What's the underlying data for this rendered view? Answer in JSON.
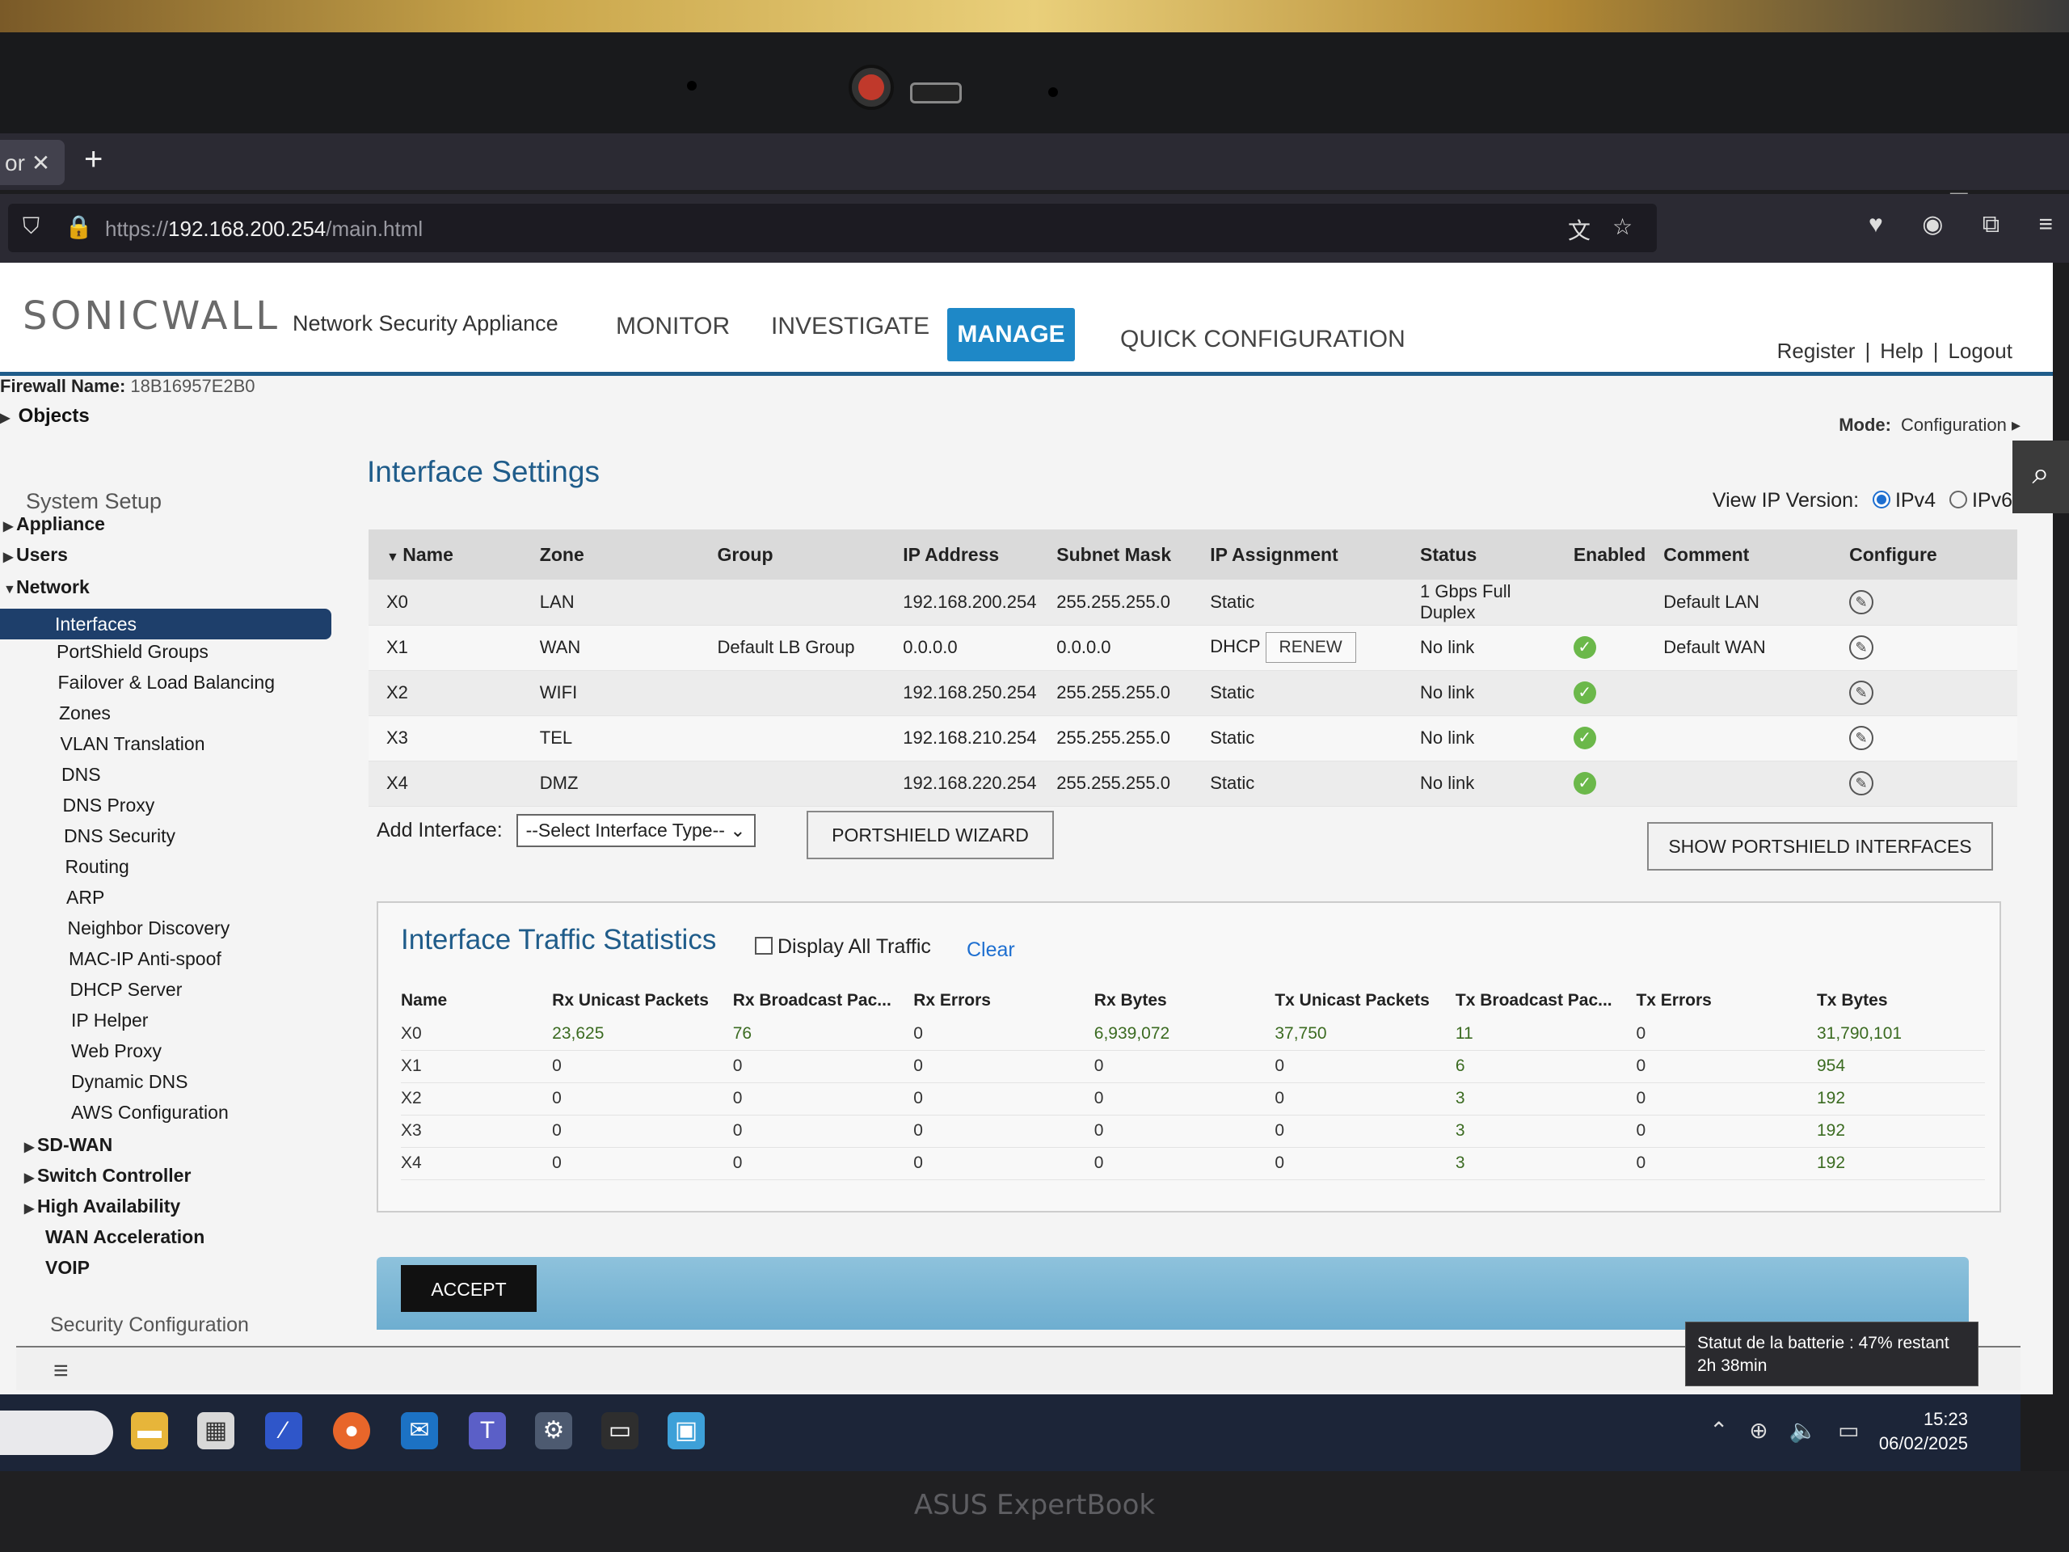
{
  "brand": "ASUS ExpertBook",
  "browser": {
    "tab_label": "or",
    "url_protocol": "https://",
    "url_host": "192.168.200.254",
    "url_path": "/main.html"
  },
  "header": {
    "logo": "SONICWALL",
    "product": "Network Security Appliance",
    "nav": [
      "MONITOR",
      "INVESTIGATE",
      "MANAGE",
      "QUICK CONFIGURATION"
    ],
    "links": [
      "Register",
      "Help",
      "Logout"
    ]
  },
  "firewall": {
    "label": "Firewall Name:",
    "value": "18B16957E2B0"
  },
  "objects": "Objects",
  "mode": {
    "label": "Mode:",
    "value": "Configuration"
  },
  "sidebar": {
    "system_setup": "System Setup",
    "items": [
      {
        "label": "Appliance",
        "bold": true
      },
      {
        "label": "Users",
        "bold": true
      },
      {
        "label": "Network",
        "bold": true
      },
      {
        "label": "Interfaces",
        "active": true
      },
      {
        "label": "PortShield Groups"
      },
      {
        "label": "Failover & Load Balancing"
      },
      {
        "label": "Zones"
      },
      {
        "label": "VLAN Translation"
      },
      {
        "label": "DNS"
      },
      {
        "label": "DNS Proxy"
      },
      {
        "label": "DNS Security"
      },
      {
        "label": "Routing"
      },
      {
        "label": "ARP"
      },
      {
        "label": "Neighbor Discovery"
      },
      {
        "label": "MAC-IP Anti-spoof"
      },
      {
        "label": "DHCP Server"
      },
      {
        "label": "IP Helper"
      },
      {
        "label": "Web Proxy"
      },
      {
        "label": "Dynamic DNS"
      },
      {
        "label": "AWS Configuration"
      },
      {
        "label": "SD-WAN",
        "bold": true
      },
      {
        "label": "Switch Controller",
        "bold": true
      },
      {
        "label": "High Availability",
        "bold": true
      },
      {
        "label": "WAN Acceleration",
        "bold": true
      },
      {
        "label": "VOIP",
        "bold": true
      }
    ],
    "security_config": "Security Configuration"
  },
  "settings": {
    "title": "Interface Settings",
    "ip_version_label": "View IP Version:",
    "ipv4": "IPv4",
    "ipv6": "IPv6",
    "columns": [
      "Name",
      "Zone",
      "Group",
      "IP Address",
      "Subnet Mask",
      "IP Assignment",
      "Status",
      "Enabled",
      "Comment",
      "Configure"
    ],
    "rows": [
      {
        "name": "X0",
        "zone": "LAN",
        "group": "",
        "ip": "192.168.200.254",
        "mask": "255.255.255.0",
        "assign": "Static",
        "renew": false,
        "status": "1 Gbps Full Duplex",
        "enabled": false,
        "comment": "Default LAN"
      },
      {
        "name": "X1",
        "zone": "WAN",
        "group": "Default LB Group",
        "ip": "0.0.0.0",
        "mask": "0.0.0.0",
        "assign": "DHCP",
        "renew": true,
        "status": "No link",
        "enabled": true,
        "comment": "Default WAN"
      },
      {
        "name": "X2",
        "zone": "WIFI",
        "group": "",
        "ip": "192.168.250.254",
        "mask": "255.255.255.0",
        "assign": "Static",
        "renew": false,
        "status": "No link",
        "enabled": true,
        "comment": ""
      },
      {
        "name": "X3",
        "zone": "TEL",
        "group": "",
        "ip": "192.168.210.254",
        "mask": "255.255.255.0",
        "assign": "Static",
        "renew": false,
        "status": "No link",
        "enabled": true,
        "comment": ""
      },
      {
        "name": "X4",
        "zone": "DMZ",
        "group": "",
        "ip": "192.168.220.254",
        "mask": "255.255.255.0",
        "assign": "Static",
        "renew": false,
        "status": "No link",
        "enabled": true,
        "comment": ""
      }
    ],
    "renew_label": "RENEW",
    "add_interface_label": "Add Interface:",
    "add_interface_select": "--Select Interface Type--",
    "portshield_wizard": "PORTSHIELD WIZARD",
    "show_portshield": "SHOW PORTSHIELD INTERFACES"
  },
  "traffic": {
    "title": "Interface Traffic Statistics",
    "display_all": "Display All Traffic",
    "clear": "Clear",
    "columns": [
      "Name",
      "Rx Unicast Packets",
      "Rx Broadcast Pac...",
      "Rx Errors",
      "Rx Bytes",
      "Tx Unicast Packets",
      "Tx Broadcast Pac...",
      "Tx Errors",
      "Tx Bytes"
    ],
    "rows": [
      [
        "X0",
        "23,625",
        "76",
        "0",
        "6,939,072",
        "37,750",
        "11",
        "0",
        "31,790,101"
      ],
      [
        "X1",
        "0",
        "0",
        "0",
        "0",
        "0",
        "6",
        "0",
        "954"
      ],
      [
        "X2",
        "0",
        "0",
        "0",
        "0",
        "0",
        "3",
        "0",
        "192"
      ],
      [
        "X3",
        "0",
        "0",
        "0",
        "0",
        "0",
        "3",
        "0",
        "192"
      ],
      [
        "X4",
        "0",
        "0",
        "0",
        "0",
        "0",
        "3",
        "0",
        "192"
      ]
    ]
  },
  "accept": "ACCEPT",
  "tooltip": {
    "line1": "Statut de la batterie : 47% restant",
    "line2": "2h 38min"
  },
  "taskbar": {
    "time": "15:23",
    "date": "06/02/2025"
  }
}
